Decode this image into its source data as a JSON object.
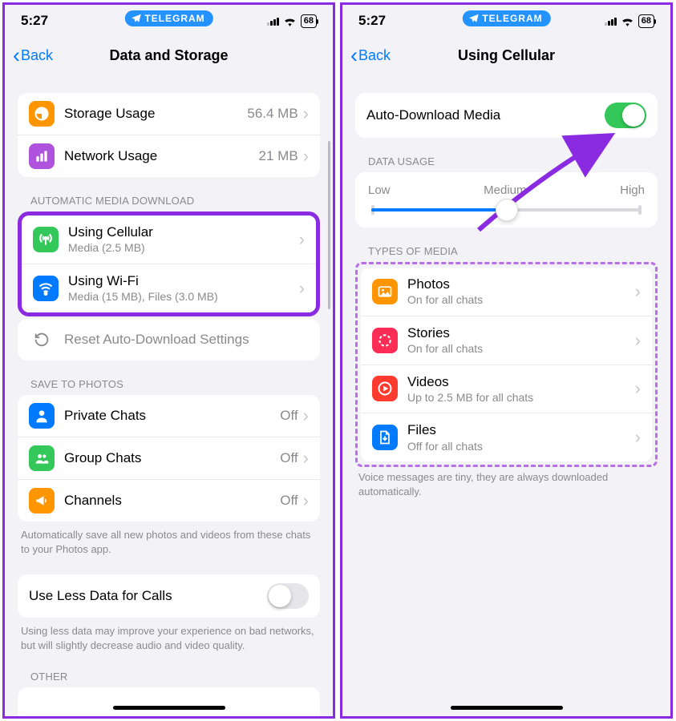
{
  "status": {
    "time": "5:27",
    "app": "TELEGRAM",
    "battery": "68"
  },
  "left": {
    "back": "Back",
    "title": "Data and Storage",
    "storage_usage_title": "Storage Usage",
    "storage_usage_value": "56.4 MB",
    "network_usage_title": "Network Usage",
    "network_usage_value": "21 MB",
    "section_auto": "AUTOMATIC MEDIA DOWNLOAD",
    "cellular_title": "Using Cellular",
    "cellular_sub": "Media (2.5 MB)",
    "wifi_title": "Using Wi-Fi",
    "wifi_sub": "Media (15 MB), Files (3.0 MB)",
    "reset": "Reset Auto-Download Settings",
    "section_save": "SAVE TO PHOTOS",
    "private_chats": "Private Chats",
    "group_chats": "Group Chats",
    "channels": "Channels",
    "off": "Off",
    "save_footer": "Automatically save all new photos and videos from these chats to your Photos app.",
    "less_data": "Use Less Data for Calls",
    "less_data_footer": "Using less data may improve your experience on bad networks, but will slightly decrease audio and video quality.",
    "section_other": "OTHER"
  },
  "right": {
    "back": "Back",
    "title": "Using Cellular",
    "auto_download": "Auto-Download Media",
    "section_data": "DATA USAGE",
    "low": "Low",
    "medium": "Medium",
    "high": "High",
    "section_types": "TYPES OF MEDIA",
    "photos": "Photos",
    "photos_sub": "On for all chats",
    "stories": "Stories",
    "stories_sub": "On for all chats",
    "videos": "Videos",
    "videos_sub": "Up to 2.5 MB for all chats",
    "files": "Files",
    "files_sub": "Off for all chats",
    "footer": "Voice messages are tiny, they are always downloaded automatically."
  },
  "colors": {
    "orange": "#ff9500",
    "purple": "#af52de",
    "green": "#34c759",
    "blue": "#007aff",
    "pink": "#ff2d55",
    "red": "#ff3b30",
    "grey": "#8e8e93"
  }
}
